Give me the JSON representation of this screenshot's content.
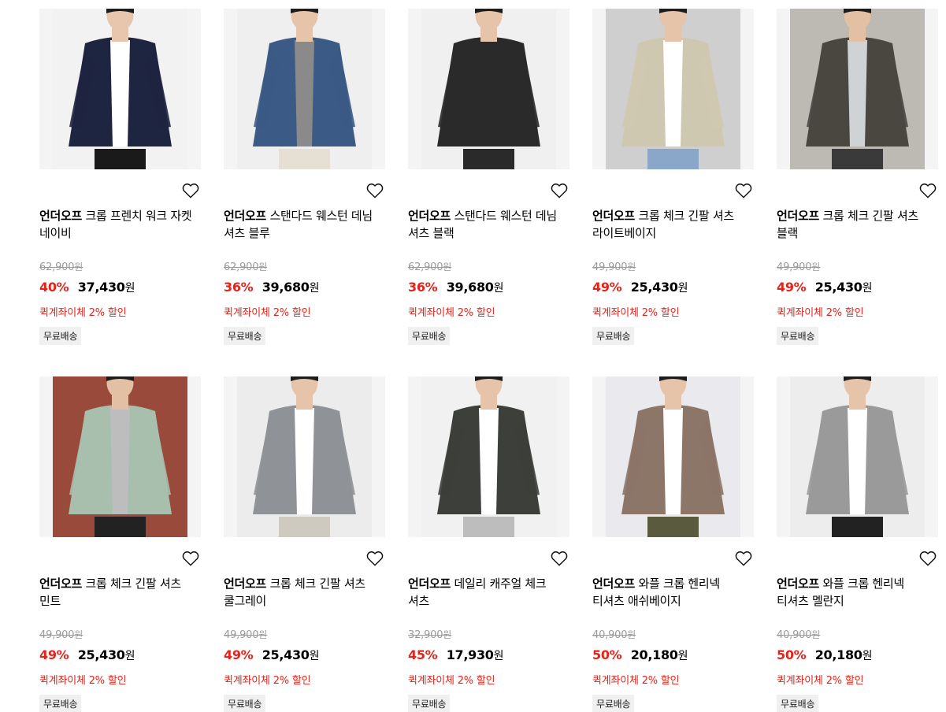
{
  "products": [
    {
      "brand": "언더오프",
      "name": "크롭 프렌치 워크 자켓 네이비",
      "original_price": "62,900",
      "discount_rate": "40%",
      "price": "37,430",
      "won": "원",
      "extra_discount": "퀵계좌이체 2% 할인",
      "badge": "무료배송",
      "photo": {
        "bg": "#f2f2f2",
        "garment": "#1e2540",
        "inner": "#ffffff",
        "pants": "#1a1a1a",
        "skin": "#e7c6ad",
        "wall": "#f2f2f2"
      }
    },
    {
      "brand": "언더오프",
      "name": "스탠다드 웨스턴 데님 셔츠 블루",
      "original_price": "62,900",
      "discount_rate": "36%",
      "price": "39,680",
      "won": "원",
      "extra_discount": "퀵계좌이체 2% 할인",
      "badge": "무료배송",
      "photo": {
        "bg": "#efefef",
        "garment": "#3b5a85",
        "inner": "#8a8a8a",
        "pants": "#e6e0d4",
        "skin": "#e6c4aa",
        "wall": "#efefef"
      }
    },
    {
      "brand": "언더오프",
      "name": "스탠다드 웨스턴 데님 셔츠 블랙",
      "original_price": "62,900",
      "discount_rate": "36%",
      "price": "39,680",
      "won": "원",
      "extra_discount": "퀵계좌이체 2% 할인",
      "badge": "무료배송",
      "photo": {
        "bg": "#f0f0f0",
        "garment": "#2a2a2a",
        "inner": "#2a2a2a",
        "pants": "#2a2a2a",
        "skin": "#e6c4aa",
        "wall": "#f0f0f0"
      }
    },
    {
      "brand": "언더오프",
      "name": "크롭 체크 긴팔 셔츠 라이트베이지",
      "original_price": "49,900",
      "discount_rate": "49%",
      "price": "25,430",
      "won": "원",
      "extra_discount": "퀵계좌이체 2% 할인",
      "badge": "무료배송",
      "photo": {
        "bg": "#d9d9d9",
        "garment": "#cfc8b0",
        "inner": "#ffffff",
        "pants": "#8aa6c8",
        "skin": "#e6c4aa",
        "wall": "#cfcfcf"
      }
    },
    {
      "brand": "언더오프",
      "name": "크롭 체크 긴팔 셔츠 블랙",
      "original_price": "49,900",
      "discount_rate": "49%",
      "price": "25,430",
      "won": "원",
      "extra_discount": "퀵계좌이체 2% 할인",
      "badge": "무료배송",
      "photo": {
        "bg": "#bdbab3",
        "garment": "#4a4640",
        "inner": "#cfd3d6",
        "pants": "#3a3a3a",
        "skin": "#e3bfa3",
        "wall": "#bdbab3"
      }
    },
    {
      "brand": "언더오프",
      "name": "크롭 체크 긴팔 셔츠 민트",
      "original_price": "49,900",
      "discount_rate": "49%",
      "price": "25,430",
      "won": "원",
      "extra_discount": "퀵계좌이체 2% 할인",
      "badge": "무료배송",
      "photo": {
        "bg": "#9a4a3a",
        "garment": "#a8bfae",
        "inner": "#bdbdbd",
        "pants": "#222222",
        "skin": "#e3bfa3",
        "wall": "#9a4a3a"
      }
    },
    {
      "brand": "언더오프",
      "name": "크롭 체크 긴팔 셔츠 쿨그레이",
      "original_price": "49,900",
      "discount_rate": "49%",
      "price": "25,430",
      "won": "원",
      "extra_discount": "퀵계좌이체 2% 할인",
      "badge": "무료배송",
      "photo": {
        "bg": "#ececec",
        "garment": "#8f9296",
        "inner": "#ffffff",
        "pants": "#cfcac0",
        "skin": "#e6c4aa",
        "wall": "#ececec"
      }
    },
    {
      "brand": "언더오프",
      "name": "데일리 캐주얼 체크 셔츠",
      "original_price": "32,900",
      "discount_rate": "45%",
      "price": "17,930",
      "won": "원",
      "extra_discount": "퀵계좌이체 2% 할인",
      "badge": "무료배송",
      "photo": {
        "bg": "#f1f1f1",
        "garment": "#3c3f3a",
        "inner": "#ffffff",
        "pants": "#bdbdbd",
        "skin": "#e6c4aa",
        "wall": "#f1f1f1"
      }
    },
    {
      "brand": "언더오프",
      "name": "와플 크롭 헨리넥 티셔츠 애쉬베이지",
      "original_price": "40,900",
      "discount_rate": "50%",
      "price": "20,180",
      "won": "원",
      "extra_discount": "퀵계좌이체 2% 할인",
      "badge": "무료배송",
      "photo": {
        "bg": "#e9e9ee",
        "garment": "#8c7668",
        "inner": "#ffffff",
        "pants": "#5a5a3e",
        "skin": "#e6c4aa",
        "wall": "#e9e9ee"
      }
    },
    {
      "brand": "언더오프",
      "name": "와플 크롭 헨리넥 티셔츠 멜란지",
      "original_price": "40,900",
      "discount_rate": "50%",
      "price": "20,180",
      "won": "원",
      "extra_discount": "퀵계좌이체 2% 할인",
      "badge": "무료배송",
      "photo": {
        "bg": "#ededed",
        "garment": "#9a9a9a",
        "inner": "#ffffff",
        "pants": "#222222",
        "skin": "#e6c4aa",
        "wall": "#ededed"
      }
    }
  ],
  "colors": {
    "accent_red": "#e4231a",
    "strike_gray": "#9a9a9a",
    "badge_bg": "#f0f0f0"
  },
  "icons": {
    "wishlist": "heart-outline-icon"
  }
}
